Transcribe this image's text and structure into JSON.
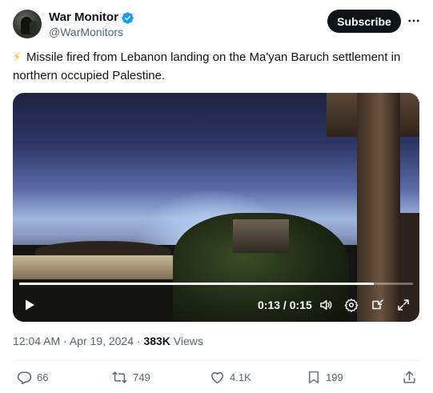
{
  "author": {
    "name": "War Monitor",
    "handle": "@WarMonitors"
  },
  "header": {
    "subscribe_label": "Subscribe"
  },
  "tweet": {
    "emoji": "⚡",
    "text": "Missile fired from Lebanon landing on the Ma'yan Baruch settlement in northern occupied Palestine."
  },
  "video": {
    "current_time": "0:13",
    "separator": " / ",
    "duration": "0:15",
    "progress_fraction": 0.9
  },
  "meta": {
    "time": "12:04 AM",
    "dot1": " · ",
    "date": "Apr 19, 2024",
    "dot2": " · ",
    "views_count": "383K",
    "views_label": " Views"
  },
  "actions": {
    "replies": "66",
    "reposts": "749",
    "likes": "4.1K",
    "bookmarks": "199"
  },
  "colors": {
    "verified_blue": "#1d9bf0",
    "bolt_yellow": "#f4b400",
    "text_primary": "#0f1419",
    "text_secondary": "#536471",
    "button_dark": "#0f1419"
  },
  "icons": [
    "verified-badge-icon",
    "more-icon",
    "play-icon",
    "volume-icon",
    "settings-icon",
    "pip-icon",
    "fullscreen-icon",
    "reply-icon",
    "repost-icon",
    "like-icon",
    "bookmark-icon",
    "share-icon"
  ]
}
